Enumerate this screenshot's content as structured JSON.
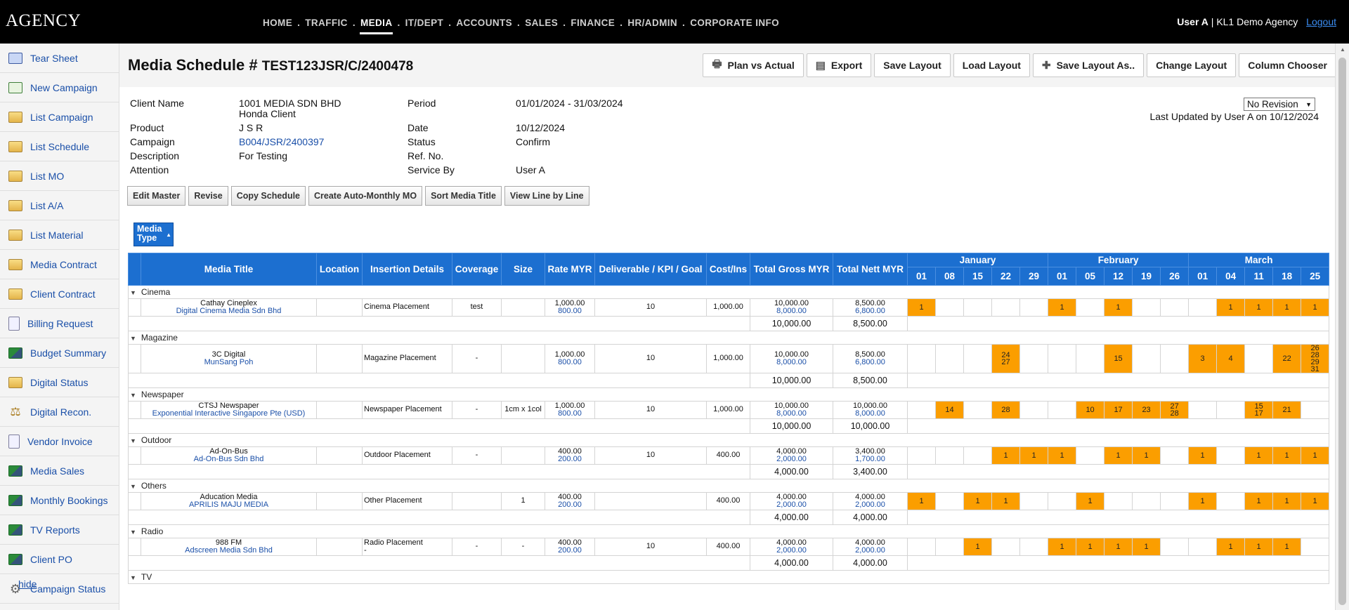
{
  "brand": "AGENCY",
  "nav": [
    "HOME",
    "TRAFFIC",
    "MEDIA",
    "IT/DEPT",
    "ACCOUNTS",
    "SALES",
    "FINANCE",
    "HR/ADMIN",
    "CORPORATE INFO"
  ],
  "nav_active": "MEDIA",
  "user": {
    "name": "User A",
    "sep": "|",
    "agency": "KL1 Demo Agency",
    "logout": "Logout"
  },
  "sidebar": [
    {
      "label": "Tear Sheet",
      "icon": "tear-sheet-icon"
    },
    {
      "label": "New Campaign",
      "icon": "new-campaign-icon"
    },
    {
      "label": "List Campaign",
      "icon": "folder-icon"
    },
    {
      "label": "List Schedule",
      "icon": "folder-icon"
    },
    {
      "label": "List MO",
      "icon": "folder-icon"
    },
    {
      "label": "List A/A",
      "icon": "folder-icon"
    },
    {
      "label": "List Material",
      "icon": "folder-icon"
    },
    {
      "label": "Media Contract",
      "icon": "folder-icon"
    },
    {
      "label": "Client Contract",
      "icon": "folder-icon"
    },
    {
      "label": "Billing Request",
      "icon": "document-icon"
    },
    {
      "label": "Budget Summary",
      "icon": "chart-icon"
    },
    {
      "label": "Digital Status",
      "icon": "folder-icon"
    },
    {
      "label": "Digital Recon.",
      "icon": "scale-icon"
    },
    {
      "label": "Vendor Invoice",
      "icon": "document-icon"
    },
    {
      "label": "Media Sales",
      "icon": "chart-icon"
    },
    {
      "label": "Monthly Bookings",
      "icon": "chart-icon"
    },
    {
      "label": "TV Reports",
      "icon": "chart-icon"
    },
    {
      "label": "Client PO",
      "icon": "chart-icon"
    },
    {
      "label": "Campaign Status",
      "icon": "gear-icon"
    }
  ],
  "hide_label": "hide",
  "page": {
    "title_prefix": "Media Schedule #",
    "code": "TEST123JSR/C/2400478"
  },
  "toolbar": [
    {
      "label": "Plan vs Actual",
      "icon": "printer-icon"
    },
    {
      "label": "Export",
      "icon": "export-icon"
    },
    {
      "label": "Save Layout",
      "icon": ""
    },
    {
      "label": "Load Layout",
      "icon": ""
    },
    {
      "label": "Save Layout As..",
      "icon": "plus-icon"
    },
    {
      "label": "Change Layout",
      "icon": ""
    },
    {
      "label": "Column Chooser",
      "icon": ""
    }
  ],
  "info": {
    "client_name_label": "Client Name",
    "client_name": "1001 MEDIA SDN BHD",
    "client_sub": "Honda Client",
    "product_label": "Product",
    "product": "J S R",
    "campaign_label": "Campaign",
    "campaign": "B004/JSR/2400397",
    "description_label": "Description",
    "description": "For Testing",
    "attention_label": "Attention",
    "period_label": "Period",
    "period": "01/01/2024 - 31/03/2024",
    "date_label": "Date",
    "date": "10/12/2024",
    "status_label": "Status",
    "status": "Confirm",
    "ref_label": "Ref. No.",
    "service_label": "Service By",
    "service": "User A"
  },
  "revision": {
    "selected": "No Revision"
  },
  "last_updated": "Last Updated by User A on 10/12/2024",
  "actions": [
    "Edit Master",
    "Revise",
    "Copy Schedule",
    "Create Auto-Monthly MO",
    "Sort Media Title",
    "View Line by Line"
  ],
  "media_type_label": "Media Type",
  "table": {
    "columns": [
      "Media Title",
      "Location",
      "Insertion Details",
      "Coverage",
      "Size",
      "Rate MYR",
      "Deliverable / KPI / Goal",
      "Cost/Ins",
      "Total Gross MYR",
      "Total Nett MYR"
    ],
    "months": [
      {
        "name": "January",
        "days": [
          "01",
          "08",
          "15",
          "22",
          "29"
        ]
      },
      {
        "name": "February",
        "days": [
          "01",
          "05",
          "12",
          "19",
          "26"
        ]
      },
      {
        "name": "March",
        "days": [
          "01",
          "04",
          "11",
          "18",
          "25"
        ]
      }
    ],
    "groups": [
      {
        "name": "Cinema",
        "rows": [
          {
            "title": "Cathay Cineplex",
            "vendor": "Digital Cinema Media Sdn Bhd",
            "location": "",
            "insertion": "Cinema Placement",
            "insertion2": "",
            "coverage": "test",
            "size": "",
            "rate": "1,000.00",
            "rate2": "800.00",
            "kpi": "10",
            "cost": "1,000.00",
            "gross": "10,000.00",
            "gross2": "8,000.00",
            "nett": "8,500.00",
            "nett2": "6,800.00",
            "spots": [
              "1",
              "",
              "",
              "",
              "",
              "1",
              "",
              "1",
              "",
              "",
              "",
              "1",
              "1",
              "1",
              "1"
            ]
          }
        ],
        "total_gross": "10,000.00",
        "total_nett": "8,500.00"
      },
      {
        "name": "Magazine",
        "rows": [
          {
            "title": "3C Digital",
            "vendor": "MunSang Poh",
            "location": "",
            "insertion": "Magazine Placement",
            "insertion2": "",
            "coverage": "-",
            "size": "",
            "rate": "1,000.00",
            "rate2": "800.00",
            "kpi": "10",
            "cost": "1,000.00",
            "gross": "10,000.00",
            "gross2": "8,000.00",
            "nett": "8,500.00",
            "nett2": "6,800.00",
            "spots": [
              "",
              "",
              "",
              "24\n27",
              "",
              "",
              "",
              "15",
              "",
              "",
              "3",
              "4",
              "",
              "22",
              "26\n28\n29\n31"
            ]
          }
        ],
        "total_gross": "10,000.00",
        "total_nett": "8,500.00"
      },
      {
        "name": "Newspaper",
        "rows": [
          {
            "title": "CTSJ Newspaper",
            "vendor": "Exponential Interactive Singapore Pte (USD)",
            "location": "",
            "insertion": "Newspaper Placement",
            "insertion2": "",
            "coverage": "-",
            "size": "1cm x 1col",
            "rate": "1,000.00",
            "rate2": "800.00",
            "kpi": "10",
            "cost": "1,000.00",
            "gross": "10,000.00",
            "gross2": "8,000.00",
            "nett": "10,000.00",
            "nett2": "8,000.00",
            "spots": [
              "",
              "14",
              "",
              "28",
              "",
              "",
              "10",
              "17",
              "23",
              "27\n28",
              "",
              "",
              "15\n17",
              "21",
              ""
            ]
          }
        ],
        "total_gross": "10,000.00",
        "total_nett": "10,000.00"
      },
      {
        "name": "Outdoor",
        "rows": [
          {
            "title": "Ad-On-Bus",
            "vendor": "Ad-On-Bus Sdn Bhd",
            "location": "",
            "insertion": "Outdoor Placement",
            "insertion2": "",
            "coverage": "-",
            "size": "",
            "rate": "400.00",
            "rate2": "200.00",
            "kpi": "10",
            "cost": "400.00",
            "gross": "4,000.00",
            "gross2": "2,000.00",
            "nett": "3,400.00",
            "nett2": "1,700.00",
            "spots": [
              "",
              "",
              "",
              "1",
              "1",
              "1",
              "",
              "1",
              "1",
              "",
              "1",
              "",
              "1",
              "1",
              "1"
            ]
          }
        ],
        "total_gross": "4,000.00",
        "total_nett": "3,400.00"
      },
      {
        "name": "Others",
        "rows": [
          {
            "title": "Aducation Media",
            "vendor": "APRILIS MAJU MEDIA",
            "location": "",
            "insertion": "Other Placement",
            "insertion2": "",
            "coverage": "",
            "size": "1",
            "rate": "400.00",
            "rate2": "200.00",
            "kpi": "",
            "cost": "400.00",
            "gross": "4,000.00",
            "gross2": "2,000.00",
            "nett": "4,000.00",
            "nett2": "2,000.00",
            "spots": [
              "1",
              "",
              "1",
              "1",
              "",
              "",
              "1",
              "",
              "",
              "",
              "1",
              "",
              "1",
              "1",
              "1"
            ]
          }
        ],
        "total_gross": "4,000.00",
        "total_nett": "4,000.00"
      },
      {
        "name": "Radio",
        "rows": [
          {
            "title": "988 FM",
            "vendor": "Adscreen Media Sdn Bhd",
            "location": "",
            "insertion": "Radio Placement",
            "insertion2": "-",
            "coverage": "-",
            "size": "-",
            "rate": "400.00",
            "rate2": "200.00",
            "kpi": "10",
            "cost": "400.00",
            "gross": "4,000.00",
            "gross2": "2,000.00",
            "nett": "4,000.00",
            "nett2": "2,000.00",
            "spots": [
              "",
              "",
              "1",
              "",
              "",
              "1",
              "1",
              "1",
              "1",
              "",
              "",
              "1",
              "1",
              "1",
              ""
            ]
          }
        ],
        "total_gross": "4,000.00",
        "total_nett": "4,000.00"
      },
      {
        "name": "TV",
        "rows": [],
        "total_gross": "",
        "total_nett": ""
      }
    ]
  },
  "colors": {
    "accent": "#1c6fd0",
    "spot": "#fb9e00",
    "link": "#1a4fa8",
    "topbar": "#000000"
  }
}
